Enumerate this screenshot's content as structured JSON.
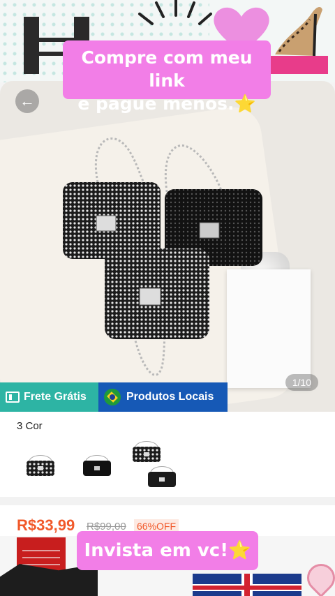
{
  "overlay": {
    "top_caption_line1": "Compre com meu link",
    "top_caption_line2": "e pague menos.⭐",
    "bottom_caption": "Invista em vc!⭐"
  },
  "product": {
    "image_counter": "1/10",
    "badges": {
      "free_shipping": "Frete Grátis",
      "local_products": "Produtos Locais"
    },
    "color_section_title": "3 Cor",
    "price_current": "R$33,99",
    "price_original": "R$99,00",
    "discount": "66%OFF"
  },
  "colors": {
    "accent_pink": "#f27ee7",
    "free_shipping_badge": "#2db4a4",
    "local_badge": "#1659b6",
    "price": "#f1592a"
  },
  "icons": {
    "back": "arrow-left-icon",
    "shipping": "truck-icon",
    "local": "brazil-flag-icon"
  }
}
